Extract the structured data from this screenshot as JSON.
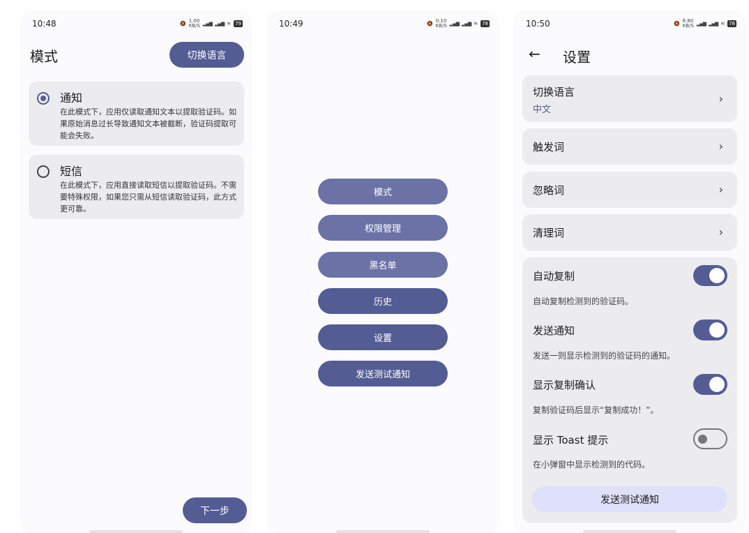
{
  "phone1": {
    "time": "10:48",
    "net_speed": "1.00\nKB/S",
    "battery": "79",
    "title": "模式",
    "lang_button": "切换语言",
    "modes": [
      {
        "name": "通知",
        "desc": "在此模式下，应用仅读取通知文本以提取验证码。如果原始消息过长导致通知文本被截断，验证码提取可能会失败。"
      },
      {
        "name": "短信",
        "desc": "在此模式下，应用直接读取短信以提取验证码。不需要特殊权限，如果您只需从短信读取验证码，此方式更可靠。"
      }
    ],
    "next_button": "下一步"
  },
  "phone2": {
    "time": "10:49",
    "net_speed": "0.10\nKB/S",
    "battery": "78",
    "menu": [
      "模式",
      "权限管理",
      "黑名单",
      "历史",
      "设置",
      "发送测试通知"
    ]
  },
  "phone3": {
    "time": "10:50",
    "net_speed": "6.80\nKB/S",
    "battery": "78",
    "title": "设置",
    "language": {
      "label": "切换语言",
      "value": "中文"
    },
    "trigger_words": "触发词",
    "ignore_words": "忽略词",
    "clean_words": "清理词",
    "toggles": [
      {
        "title": "自动复制",
        "desc": "自动复制检测到的验证码。",
        "on": true
      },
      {
        "title": "发送通知",
        "desc": "发送一则显示检测到的验证码的通知。",
        "on": true
      },
      {
        "title": "显示复制确认",
        "desc": "复制验证码后显示“复制成功！”。",
        "on": true
      },
      {
        "title": "显示 Toast 提示",
        "desc": "在小弹窗中显示检测到的代码。",
        "on": false
      }
    ],
    "test_button": "发送测试通知"
  },
  "colors": {
    "accent": "#545c94",
    "card": "#ececf0",
    "tonal": "#dfe0fa"
  }
}
